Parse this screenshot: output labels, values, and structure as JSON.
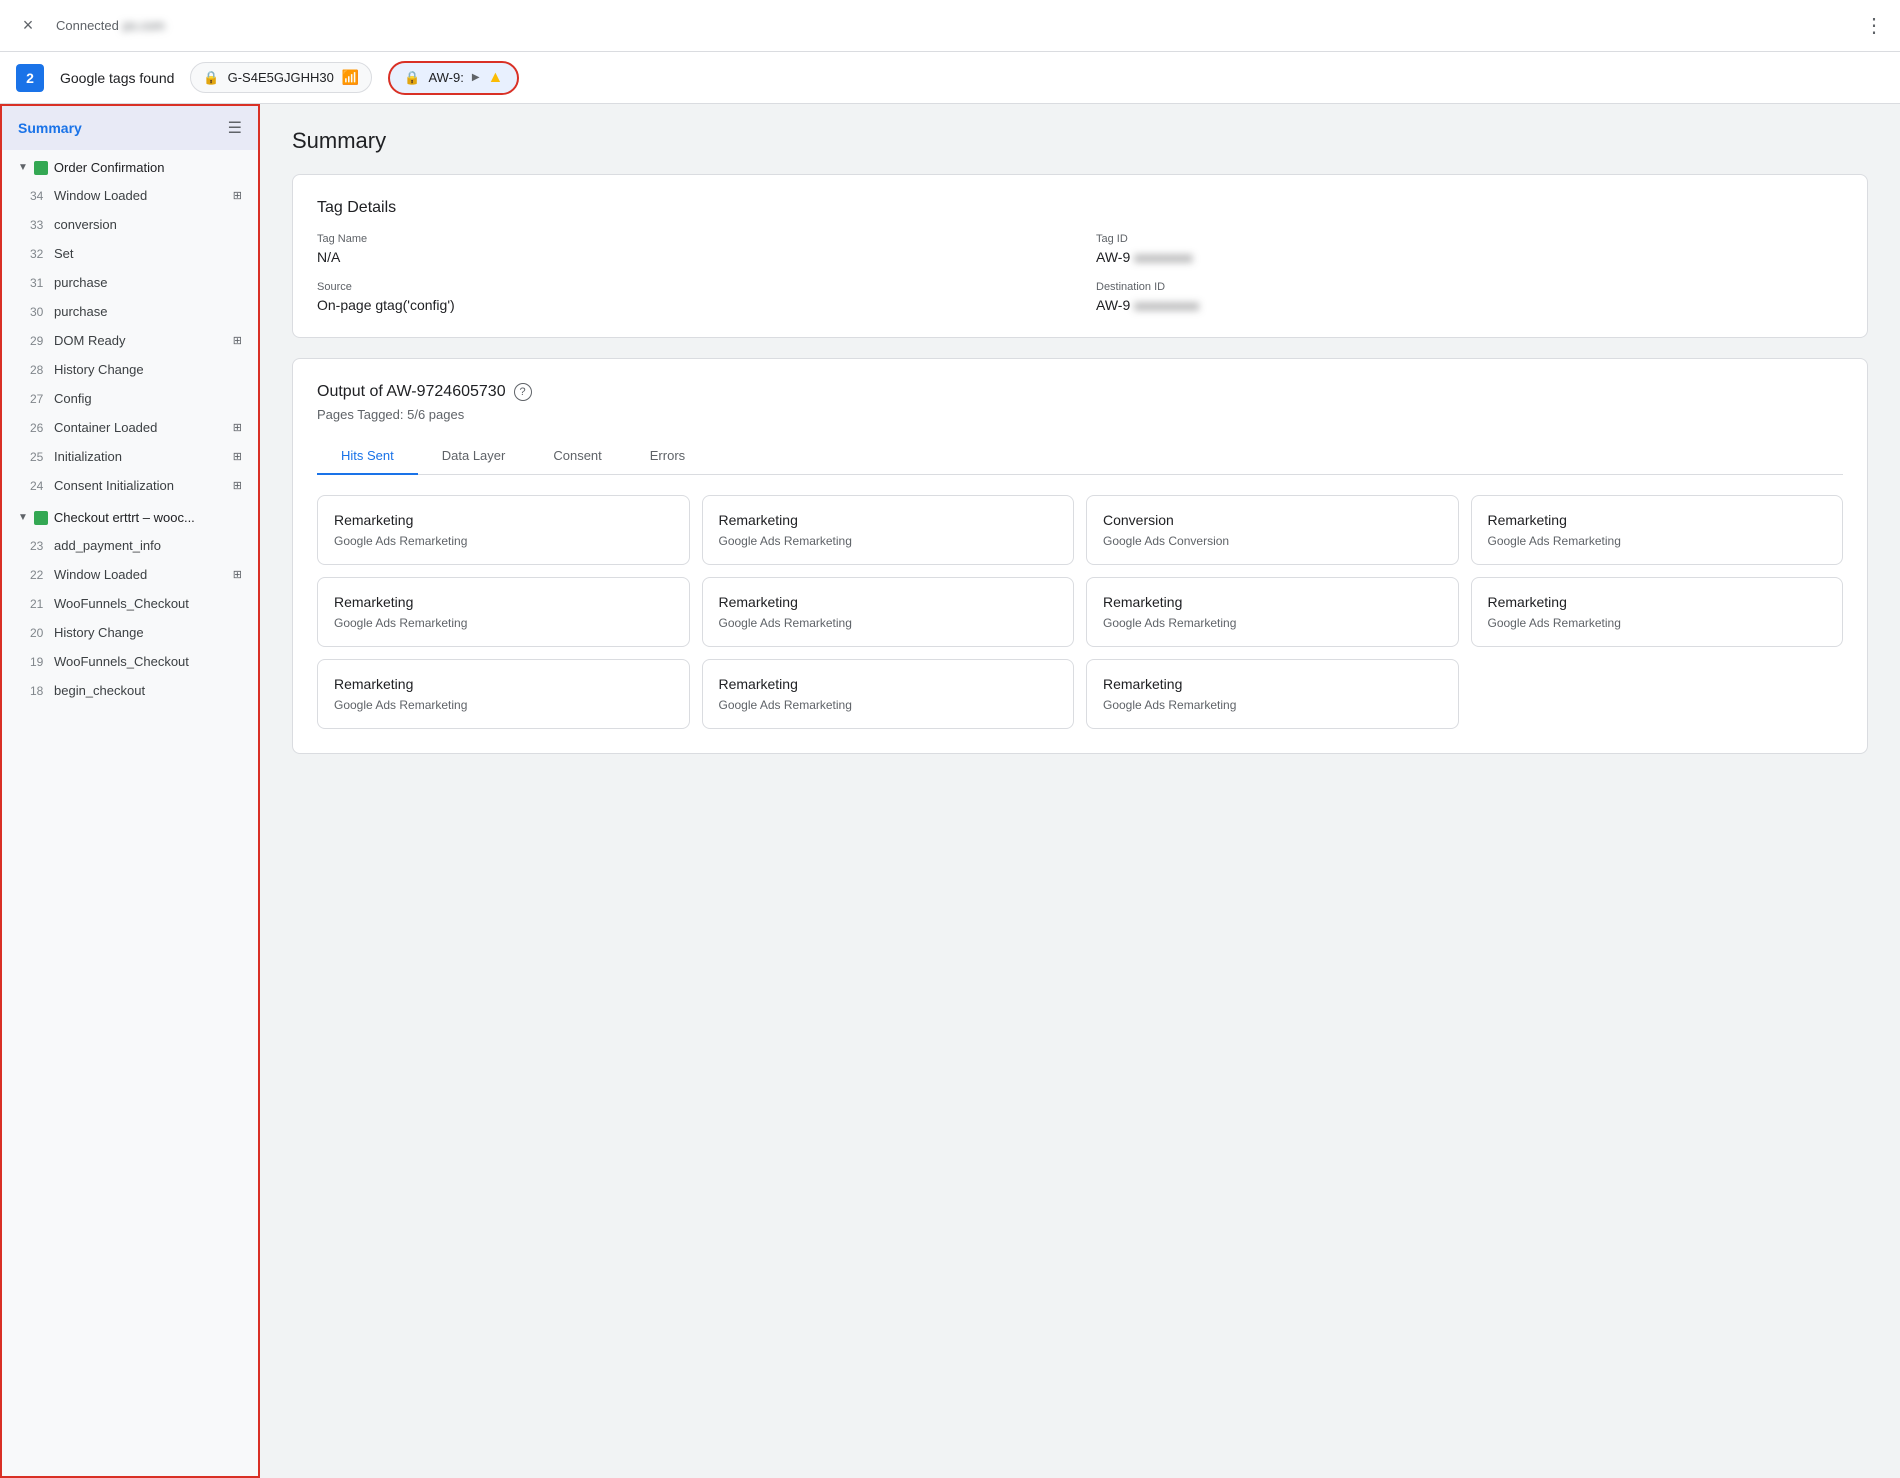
{
  "topBar": {
    "closeLabel": "×",
    "connectionStatus": "Connected",
    "domain": "ps.com",
    "moreIcon": "⋮"
  },
  "tagBar": {
    "tagCount": "2",
    "googleTagsLabel": "Google tags found",
    "tags": [
      {
        "id": "tag-ga",
        "label": "G-S4E5GJGHH30",
        "type": "ga"
      },
      {
        "id": "tag-aw",
        "label": "AW-9:",
        "type": "ads",
        "selected": true
      }
    ]
  },
  "sidebar": {
    "headerTitle": "Summary",
    "sections": [
      {
        "id": "order-confirmation",
        "label": "Order Confirmation",
        "expanded": true,
        "items": [
          {
            "num": "34",
            "label": "Window Loaded",
            "hasIcon": true
          },
          {
            "num": "33",
            "label": "conversion",
            "hasIcon": false
          },
          {
            "num": "32",
            "label": "Set",
            "hasIcon": false
          },
          {
            "num": "31",
            "label": "purchase",
            "hasIcon": false
          },
          {
            "num": "30",
            "label": "purchase",
            "hasIcon": false
          },
          {
            "num": "29",
            "label": "DOM Ready",
            "hasIcon": true
          },
          {
            "num": "28",
            "label": "History Change",
            "hasIcon": false
          },
          {
            "num": "27",
            "label": "Config",
            "hasIcon": false
          },
          {
            "num": "26",
            "label": "Container Loaded",
            "hasIcon": true
          },
          {
            "num": "25",
            "label": "Initialization",
            "hasIcon": true
          },
          {
            "num": "24",
            "label": "Consent Initialization",
            "hasIcon": true
          }
        ]
      },
      {
        "id": "checkout",
        "label": "Checkout erttrt – wooc...",
        "expanded": true,
        "items": [
          {
            "num": "23",
            "label": "add_payment_info",
            "hasIcon": false
          },
          {
            "num": "22",
            "label": "Window Loaded",
            "hasIcon": true
          },
          {
            "num": "21",
            "label": "WooFunnels_Checkout",
            "hasIcon": false
          },
          {
            "num": "20",
            "label": "History Change",
            "hasIcon": false
          },
          {
            "num": "19",
            "label": "WooFunnels_Checkout",
            "hasIcon": false
          },
          {
            "num": "18",
            "label": "begin_checkout",
            "hasIcon": false
          }
        ]
      }
    ]
  },
  "content": {
    "pageTitle": "Summary",
    "tagDetails": {
      "sectionTitle": "Tag Details",
      "tagNameLabel": "Tag Name",
      "tagNameValue": "N/A",
      "tagIdLabel": "Tag ID",
      "tagIdValue": "AW-9",
      "sourceLabel": "Source",
      "sourceValue": "On-page gtag('config')",
      "destIdLabel": "Destination ID",
      "destIdValue": "AW-9"
    },
    "output": {
      "title": "Output of AW-9724605730",
      "pagesTagged": "Pages Tagged: 5/6 pages",
      "tabs": [
        {
          "id": "hits-sent",
          "label": "Hits Sent",
          "active": true
        },
        {
          "id": "data-layer",
          "label": "Data Layer",
          "active": false
        },
        {
          "id": "consent",
          "label": "Consent",
          "active": false
        },
        {
          "id": "errors",
          "label": "Errors",
          "active": false
        }
      ],
      "hitCards": [
        {
          "title": "Remarketing",
          "subtitle": "Google Ads Remarketing"
        },
        {
          "title": "Remarketing",
          "subtitle": "Google Ads Remarketing"
        },
        {
          "title": "Conversion",
          "subtitle": "Google Ads Conversion"
        },
        {
          "title": "Remarketing",
          "subtitle": "Google Ads Remarketing"
        },
        {
          "title": "Remarketing",
          "subtitle": "Google Ads Remarketing"
        },
        {
          "title": "Remarketing",
          "subtitle": "Google Ads Remarketing"
        },
        {
          "title": "Remarketing",
          "subtitle": "Google Ads Remarketing"
        },
        {
          "title": "Remarketing",
          "subtitle": "Google Ads Remarketing"
        },
        {
          "title": "Remarketing",
          "subtitle": "Google Ads Remarketing"
        },
        {
          "title": "Remarketing",
          "subtitle": "Google Ads Remarketing"
        },
        {
          "title": "Remarketing",
          "subtitle": "Google Ads Remarketing"
        }
      ]
    }
  }
}
